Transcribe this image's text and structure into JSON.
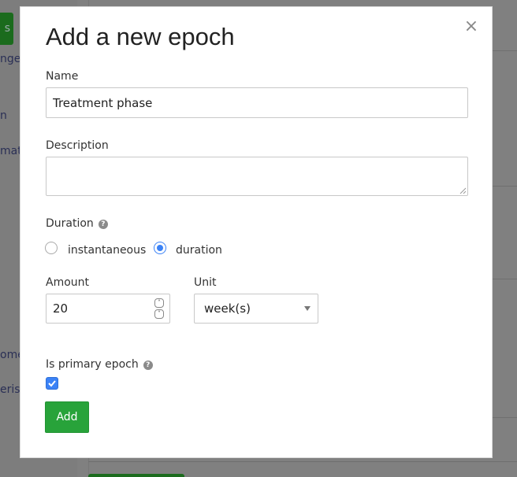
{
  "background": {
    "button_fragment": "s",
    "link_fragments": [
      "nges",
      "n",
      "mati",
      "ome",
      "eris"
    ]
  },
  "modal": {
    "title": "Add a new epoch",
    "close_icon": "×",
    "name": {
      "label": "Name",
      "value": "Treatment phase"
    },
    "description": {
      "label": "Description",
      "value": ""
    },
    "duration": {
      "label": "Duration",
      "help_icon": "?",
      "options": [
        {
          "label": "instantaneous",
          "selected": false
        },
        {
          "label": "duration",
          "selected": true
        }
      ]
    },
    "amount": {
      "label": "Amount",
      "value": "20",
      "spin_up": "˄",
      "spin_down": "˅"
    },
    "unit": {
      "label": "Unit",
      "value": "week(s)"
    },
    "primary": {
      "label": "Is primary epoch",
      "help_icon": "?",
      "checked": true
    },
    "add_button": "Add"
  },
  "colors": {
    "accent_blue": "#3b82f6",
    "button_green": "#28a33a",
    "overlay_gray": "#808080"
  }
}
